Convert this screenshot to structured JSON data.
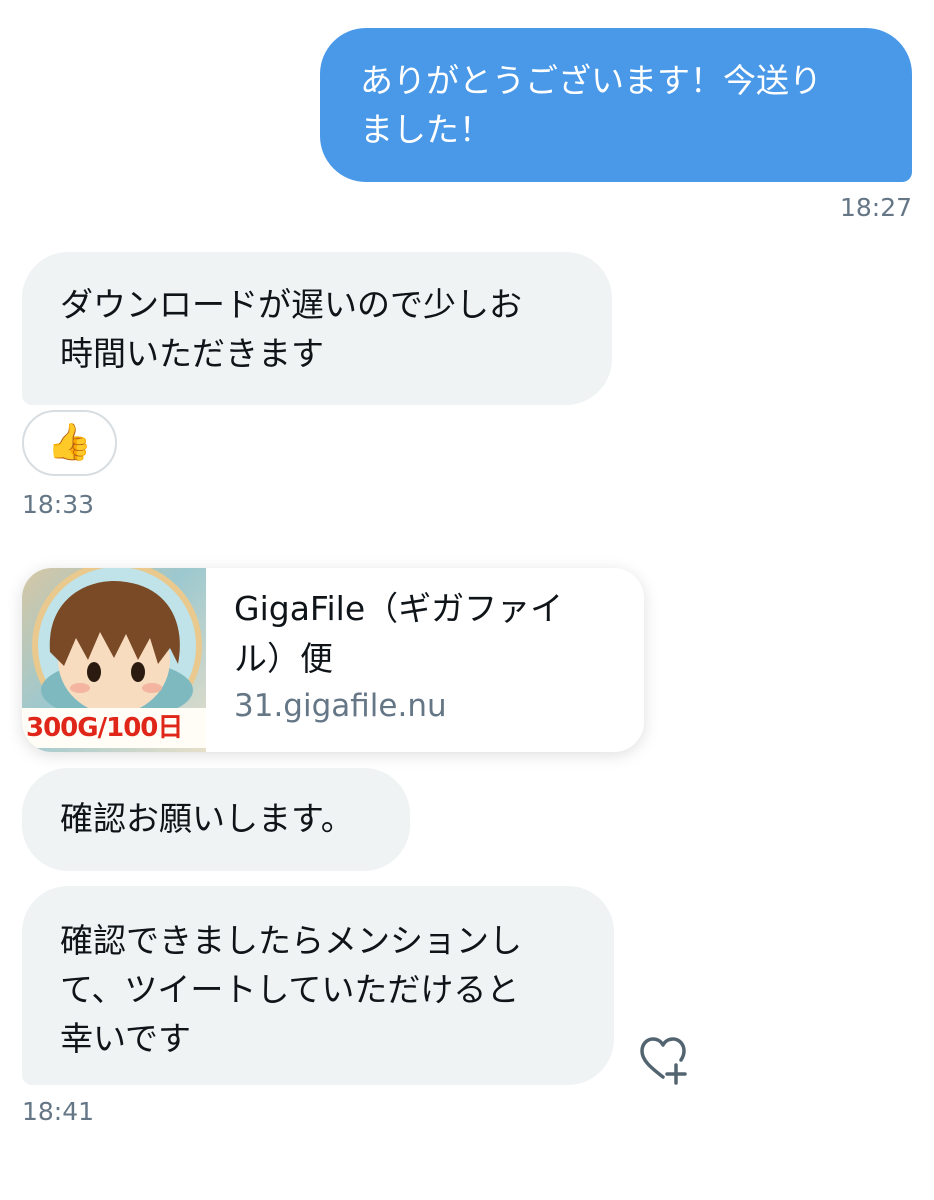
{
  "messages": {
    "sent_1": {
      "text": "ありがとうございます！今送り\nました！",
      "time": "18:27"
    },
    "received_1": {
      "text": "ダウンロードが遅いので少しお\n時間いただきます",
      "time": "18:33",
      "reaction": "👍"
    },
    "link_card": {
      "title": "GigaFile（ギガファイ\nル）便",
      "domain": "31.gigafile.nu",
      "thumb_banner": "300G/100日"
    },
    "received_2": {
      "text": "確認お願いします。"
    },
    "received_3": {
      "text": "確認できましたらメンションし\nて、ツイートしていただけると\n幸いです",
      "time": "18:41"
    }
  },
  "icons": {
    "reaction": "thumbs-up-icon",
    "like": "heart-plus-icon"
  },
  "colors": {
    "sent_bubble": "#4a99e9",
    "received_bubble": "#eff3f4",
    "timestamp": "#657786"
  }
}
